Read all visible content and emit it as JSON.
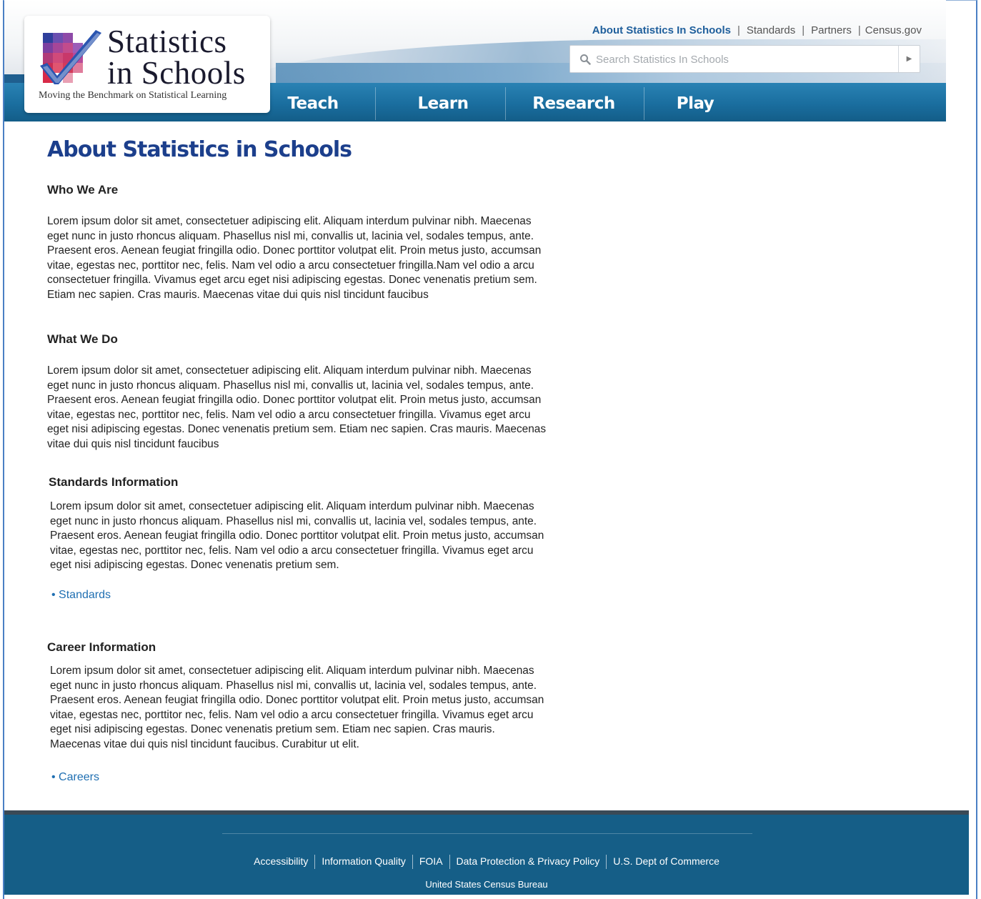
{
  "brand": {
    "title_line1": "Statistics",
    "title_line2": "in Schools",
    "tagline": "Moving the Benchmark on Statistical Learning"
  },
  "top_links": [
    "About Statistics In Schools",
    "Standards",
    "Partners",
    "Census.gov"
  ],
  "search": {
    "placeholder": "Search Statistics In Schools"
  },
  "nav": [
    "Teach",
    "Learn",
    "Research",
    "Play"
  ],
  "page": {
    "title": "About Statistics in Schools",
    "sections": [
      {
        "heading": "Who We Are",
        "lines": [
          "Lorem ipsum dolor sit amet, consectetuer adipiscing elit. Aliquam interdum pulvinar nibh. Maecenas",
          "eget nunc in justo rhoncus aliquam. Phasellus nisl mi, convallis ut, lacinia vel, sodales tempus, ante.",
          "Praesent eros. Aenean feugiat fringilla odio. Donec porttitor volutpat elit. Proin metus justo, accumsan",
          "vitae, egestas nec, porttitor nec, felis. Nam vel odio a arcu consectetuer fringilla.Nam vel odio a arcu",
          "consectetuer fringilla. Vivamus eget arcu eget nisi adipiscing egestas. Donec venenatis pretium sem.",
          "Etiam nec sapien. Cras mauris. Maecenas vitae dui quis nisl tincidunt faucibus"
        ]
      },
      {
        "heading": "What We Do",
        "lines": [
          "Lorem ipsum dolor sit amet, consectetuer adipiscing elit. Aliquam interdum pulvinar nibh. Maecenas",
          "eget nunc in justo rhoncus aliquam. Phasellus nisl mi, convallis ut, lacinia vel, sodales tempus, ante.",
          "Praesent eros. Aenean feugiat fringilla odio. Donec porttitor volutpat elit. Proin metus justo, accumsan",
          "vitae, egestas nec, porttitor nec, felis. Nam vel odio a arcu consectetuer fringilla. Vivamus eget arcu",
          "eget nisi adipiscing egestas. Donec venenatis pretium sem. Etiam nec sapien. Cras mauris. Maecenas",
          "vitae dui quis nisl tincidunt faucibus"
        ]
      },
      {
        "heading": "Standards Information",
        "lines": [
          "Lorem ipsum dolor sit amet, consectetuer adipiscing elit. Aliquam interdum pulvinar nibh. Maecenas",
          "eget nunc in justo rhoncus aliquam. Phasellus nisl mi, convallis ut, lacinia vel, sodales tempus, ante.",
          "Praesent eros. Aenean feugiat fringilla odio. Donec porttitor volutpat elit. Proin metus justo, accumsan",
          "vitae, egestas nec, porttitor nec, felis. Nam vel odio a arcu consectetuer fringilla. Vivamus eget arcu",
          "eget nisi adipiscing egestas. Donec venenatis pretium sem."
        ],
        "link": "• Standards"
      },
      {
        "heading": "Career Information",
        "lines": [
          "Lorem ipsum dolor sit amet, consectetuer adipiscing elit. Aliquam interdum pulvinar nibh. Maecenas",
          "eget nunc in justo rhoncus aliquam. Phasellus nisl mi, convallis ut, lacinia vel, sodales tempus, ante.",
          "Praesent eros. Aenean feugiat fringilla odio. Donec porttitor volutpat elit. Proin metus justo, accumsan",
          "vitae, egestas nec, porttitor nec, felis. Nam vel odio a arcu consectetuer fringilla. Vivamus eget arcu",
          "eget nisi adipiscing egestas. Donec venenatis pretium sem. Etiam nec sapien. Cras mauris.",
          "Maecenas vitae dui quis nisl tincidunt faucibus. Curabitur ut elit."
        ],
        "link": "• Careers"
      }
    ]
  },
  "footer": {
    "links": [
      "Accessibility",
      "Information Quality",
      "FOIA",
      "Data Protection & Privacy Policy",
      "U.S. Dept of Commerce"
    ],
    "sub": "United States Census Bureau"
  },
  "colors": {
    "brand_blue": "#1c3f8c",
    "nav_blue": "#1a6e9f",
    "footer_blue": "#155e87",
    "link_blue": "#1f6fb2"
  },
  "icons": {
    "search": "search-icon",
    "go": "arrow-right-icon",
    "logo": "checkmark-logo-icon"
  }
}
